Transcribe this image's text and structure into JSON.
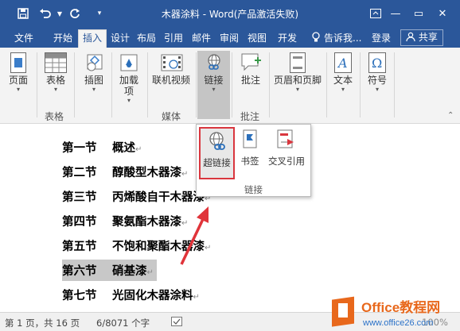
{
  "window": {
    "title": "木器涂料 - Word(产品激活失败)",
    "minimize": "—",
    "restore": "▭",
    "close": "✕",
    "ribbon_opts": "⌃"
  },
  "quick_access": {
    "save_icon": "save-icon",
    "undo_icon": "undo-icon",
    "redo_icon": "redo-icon",
    "customize_icon": "dropdown-icon"
  },
  "tabs": [
    "文件",
    "开始",
    "插入",
    "设计",
    "布局",
    "引用",
    "邮件",
    "审阅",
    "视图",
    "开发"
  ],
  "tabs_extra": {
    "tell_me": "告诉我...",
    "login": "登录",
    "share": "共享"
  },
  "ribbon": {
    "page": "页面",
    "table": "表格",
    "illustrations": "插图",
    "addins": "加载项",
    "online_video": "联机视频",
    "links": "链接",
    "comment": "批注",
    "header_footer": "页眉和页脚",
    "text": "文本",
    "symbols": "符号",
    "group_table": "表格",
    "group_media": "媒体",
    "group_comment": "批注"
  },
  "popup": {
    "hyperlink": "超链接",
    "bookmark": "书签",
    "cross_ref": "交叉引用",
    "group": "链接"
  },
  "document": {
    "lines": [
      {
        "num": "第一节",
        "text": "概述"
      },
      {
        "num": "第二节",
        "text": "醇酸型木器漆"
      },
      {
        "num": "第三节",
        "text": "丙烯酸自干木器漆"
      },
      {
        "num": "第四节",
        "text": "聚氨酯木器漆"
      },
      {
        "num": "第五节",
        "text": "不饱和聚酯木器漆"
      },
      {
        "num": "第六节",
        "text": "硝基漆"
      },
      {
        "num": "第七节",
        "text": "光固化木器涂料"
      }
    ],
    "para_mark": "↵"
  },
  "status": {
    "page": "第 1 页，共 16 页",
    "words": "6/8071 个字",
    "zoom": "100%"
  },
  "logo": {
    "name": "Office教程网",
    "url": "www.office26.com"
  },
  "colors": {
    "brand": "#2b579a",
    "highlight": "#d9363e",
    "logo_orange": "#e8681c"
  }
}
